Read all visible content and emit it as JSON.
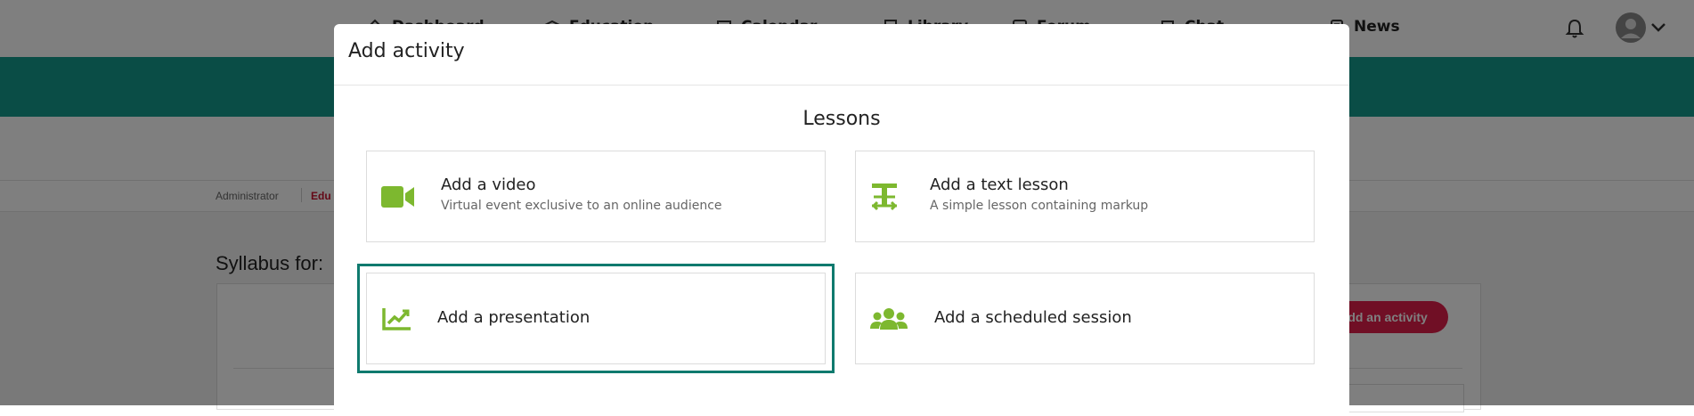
{
  "nav": {
    "items": [
      {
        "label": "Dashboard",
        "icon": "home-icon"
      },
      {
        "label": "Education",
        "icon": "education-icon"
      },
      {
        "label": "Calendar",
        "icon": "calendar-icon"
      },
      {
        "label": "Library",
        "icon": "library-icon"
      },
      {
        "label": "Forum",
        "icon": "forum-icon"
      },
      {
        "label": "Chat",
        "icon": "chat-icon"
      },
      {
        "label": "News",
        "icon": "news-icon"
      }
    ],
    "notification_icon": "bell-icon",
    "avatar_icon": "user-avatar-icon",
    "dropdown_icon": "chevron-down-icon"
  },
  "breadcrumb": {
    "items": [
      "Administrator",
      "Edu"
    ]
  },
  "page": {
    "syllabus_title": "Syllabus for:",
    "add_activity_button": "Add an activity"
  },
  "modal": {
    "title": "Add activity",
    "section_title": "Lessons",
    "cards": [
      {
        "title": "Add a video",
        "subtitle": "Virtual event exclusive to an online audience",
        "icon": "video-camera-icon"
      },
      {
        "title": "Add a text lesson",
        "subtitle": "A simple lesson containing markup",
        "icon": "text-height-icon"
      },
      {
        "title": "Add a presentation",
        "subtitle": "",
        "icon": "chart-line-icon",
        "selected": true
      },
      {
        "title": "Add a scheduled session",
        "subtitle": "",
        "icon": "users-group-icon"
      }
    ]
  },
  "colors": {
    "teal": "#159a8c",
    "selection_outline": "#0f7a6e",
    "icon_green": "#7db82f",
    "brand_red": "#e01e4b"
  }
}
